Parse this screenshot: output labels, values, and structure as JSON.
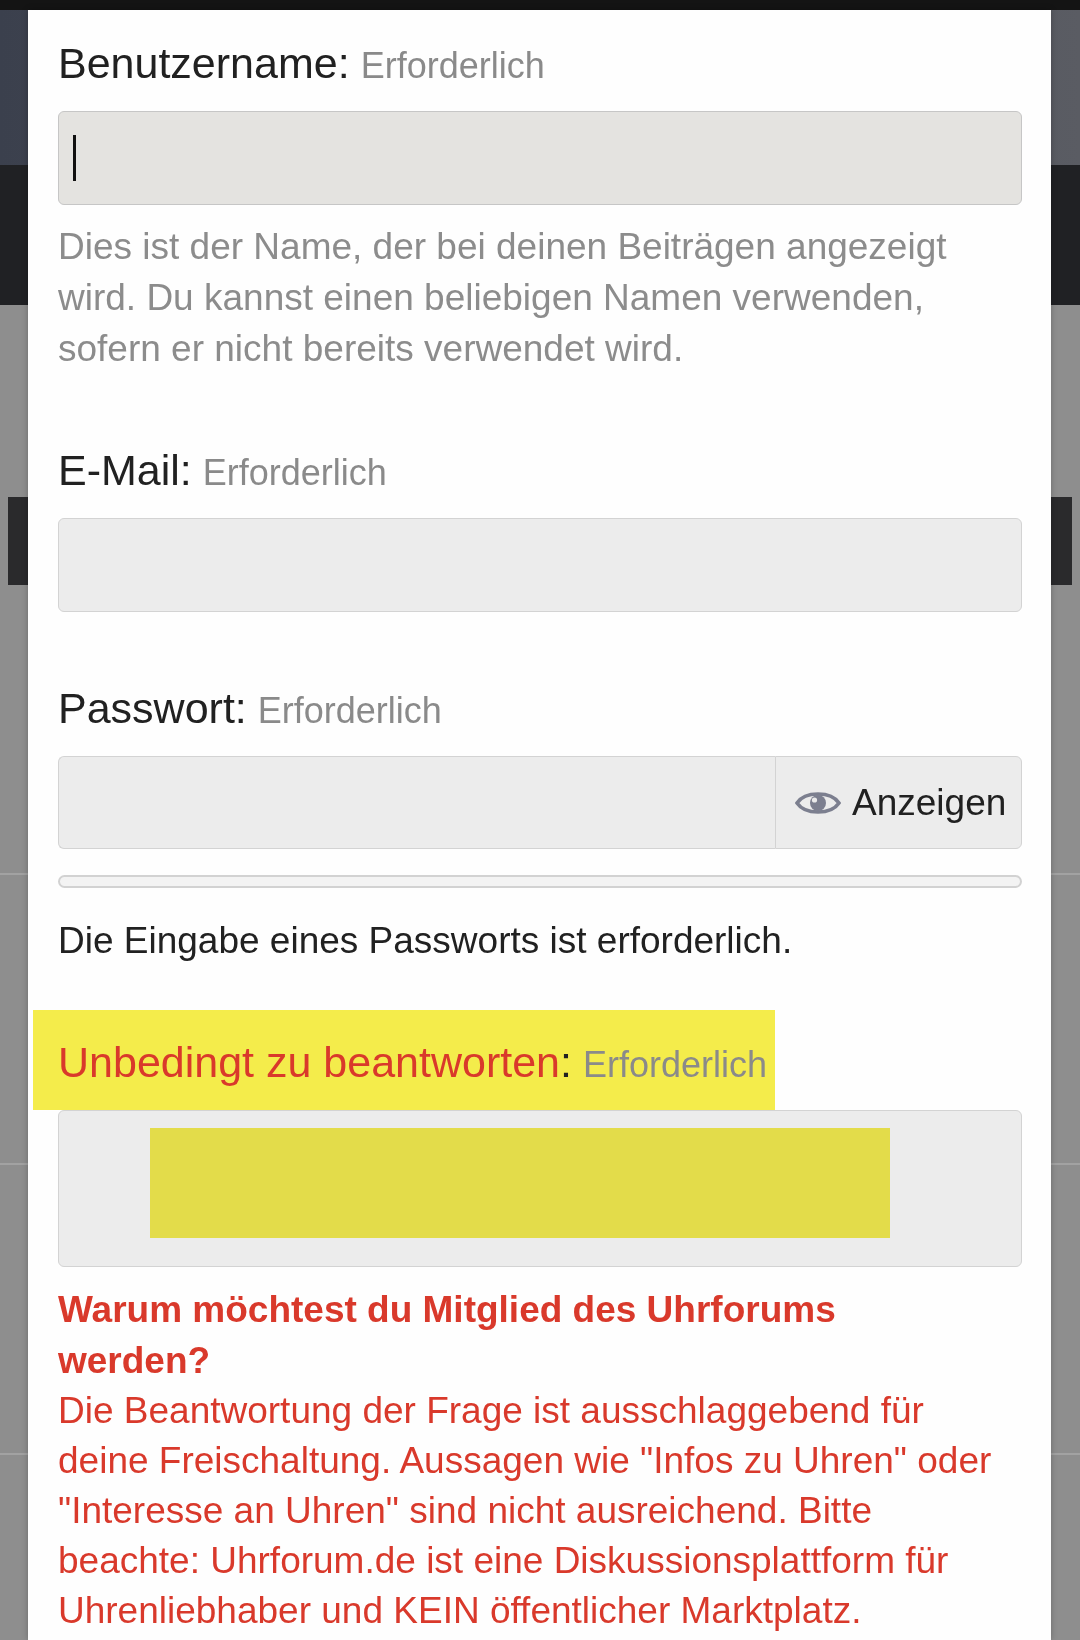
{
  "fields": [
    {
      "kind": "text",
      "label": "Benutzername:",
      "required_note": "Erforderlich",
      "alert": false,
      "focused": true,
      "hint": "Dies ist der Name, der bei deinen Beiträgen angezeigt wird. Du kannst einen beliebigen Namen verwenden, sofern er nicht bereits verwendet wird."
    },
    {
      "kind": "text",
      "label": "E-Mail:",
      "required_note": "Erforderlich",
      "alert": false,
      "focused": false
    },
    {
      "kind": "password",
      "label": "Passwort:",
      "required_note": "Erforderlich",
      "alert": false,
      "focused": false,
      "reveal_button": "Anzeigen",
      "message": "Die Eingabe eines Passworts ist erforderlich."
    },
    {
      "kind": "textarea",
      "label": "Unbedingt zu beantworten",
      "label_suffix": ":",
      "required_note": "Erforderlich",
      "alert": true,
      "highlighted": true,
      "focused": false,
      "redacted": true,
      "question": "Warum möchtest du Mitglied des Uhrforums werden?",
      "explanation": "Die Beantwortung der Frage ist ausschlaggebend für deine Freischaltung. Aussagen wie \"Infos zu Uhren\" oder \"Interesse an Uhren\" sind nicht ausreichend. Bitte beachte: Uhrforum.de ist eine Diskussionsplattform für Uhrenliebhaber und KEIN öffentlicher Marktplatz."
    }
  ]
}
